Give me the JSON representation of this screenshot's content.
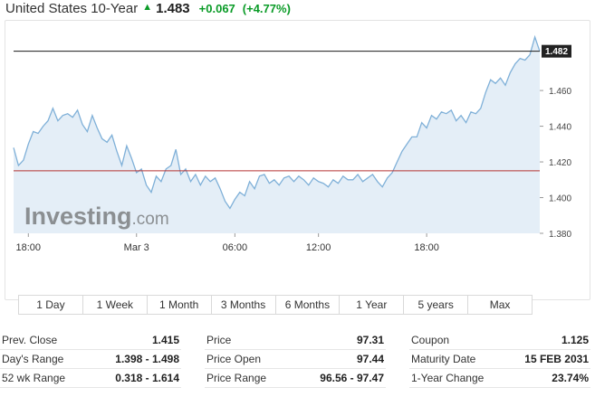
{
  "header": {
    "instrument": "United States 10-Year",
    "price": "1.483",
    "change": "+0.067",
    "change_pct": "(+4.77%)",
    "up_color": "#0a9b27"
  },
  "watermark": {
    "brand": "Investing",
    "suffix": ".com"
  },
  "chart_data": {
    "type": "area",
    "current_value_label": "1.482",
    "prev_close": 1.415,
    "ylim": [
      1.38,
      1.495
    ],
    "yticks": [
      1.46,
      1.44,
      1.42,
      1.4,
      1.38
    ],
    "ytick_labels": [
      "1.460",
      "1.440",
      "1.420",
      "1.400",
      "1.380"
    ],
    "xtick_labels": [
      "18:00",
      "Mar 3",
      "06:00",
      "12:00",
      "18:00"
    ],
    "xtick_index": [
      3,
      25,
      45,
      62,
      84
    ],
    "colors": {
      "line": "#7fb0d8",
      "fill": "#e4eef7",
      "prev_close_line": "#b53131",
      "current_line": "#1a1a1a"
    },
    "values": [
      1.428,
      1.418,
      1.421,
      1.43,
      1.437,
      1.436,
      1.44,
      1.443,
      1.45,
      1.443,
      1.446,
      1.447,
      1.445,
      1.449,
      1.441,
      1.437,
      1.446,
      1.439,
      1.433,
      1.431,
      1.435,
      1.426,
      1.418,
      1.429,
      1.422,
      1.414,
      1.416,
      1.407,
      1.403,
      1.412,
      1.409,
      1.416,
      1.418,
      1.427,
      1.413,
      1.416,
      1.409,
      1.413,
      1.407,
      1.412,
      1.409,
      1.411,
      1.405,
      1.398,
      1.394,
      1.399,
      1.403,
      1.401,
      1.409,
      1.405,
      1.412,
      1.413,
      1.408,
      1.41,
      1.407,
      1.411,
      1.412,
      1.409,
      1.412,
      1.41,
      1.407,
      1.411,
      1.409,
      1.408,
      1.406,
      1.41,
      1.408,
      1.412,
      1.41,
      1.41,
      1.413,
      1.409,
      1.411,
      1.413,
      1.409,
      1.406,
      1.411,
      1.414,
      1.42,
      1.426,
      1.43,
      1.434,
      1.434,
      1.442,
      1.439,
      1.446,
      1.444,
      1.448,
      1.447,
      1.449,
      1.443,
      1.446,
      1.442,
      1.448,
      1.447,
      1.45,
      1.459,
      1.466,
      1.464,
      1.467,
      1.463,
      1.47,
      1.475,
      1.478,
      1.477,
      1.48,
      1.49,
      1.482
    ]
  },
  "range_buttons": [
    "1 Day",
    "1 Week",
    "1 Month",
    "3 Months",
    "6 Months",
    "1 Year",
    "5 years",
    "Max"
  ],
  "stats": {
    "col1": [
      {
        "label": "Prev. Close",
        "value": "1.415"
      },
      {
        "label": "Day's Range",
        "value": "1.398 - 1.498"
      },
      {
        "label": "52 wk Range",
        "value": "0.318 - 1.614"
      }
    ],
    "col2": [
      {
        "label": "Price",
        "value": "97.31"
      },
      {
        "label": "Price Open",
        "value": "97.44"
      },
      {
        "label": "Price Range",
        "value": "96.56 - 97.47"
      }
    ],
    "col3": [
      {
        "label": "Coupon",
        "value": "1.125"
      },
      {
        "label": "Maturity Date",
        "value": "15 FEB 2031"
      },
      {
        "label": "1-Year Change",
        "value": "23.74%"
      }
    ]
  }
}
